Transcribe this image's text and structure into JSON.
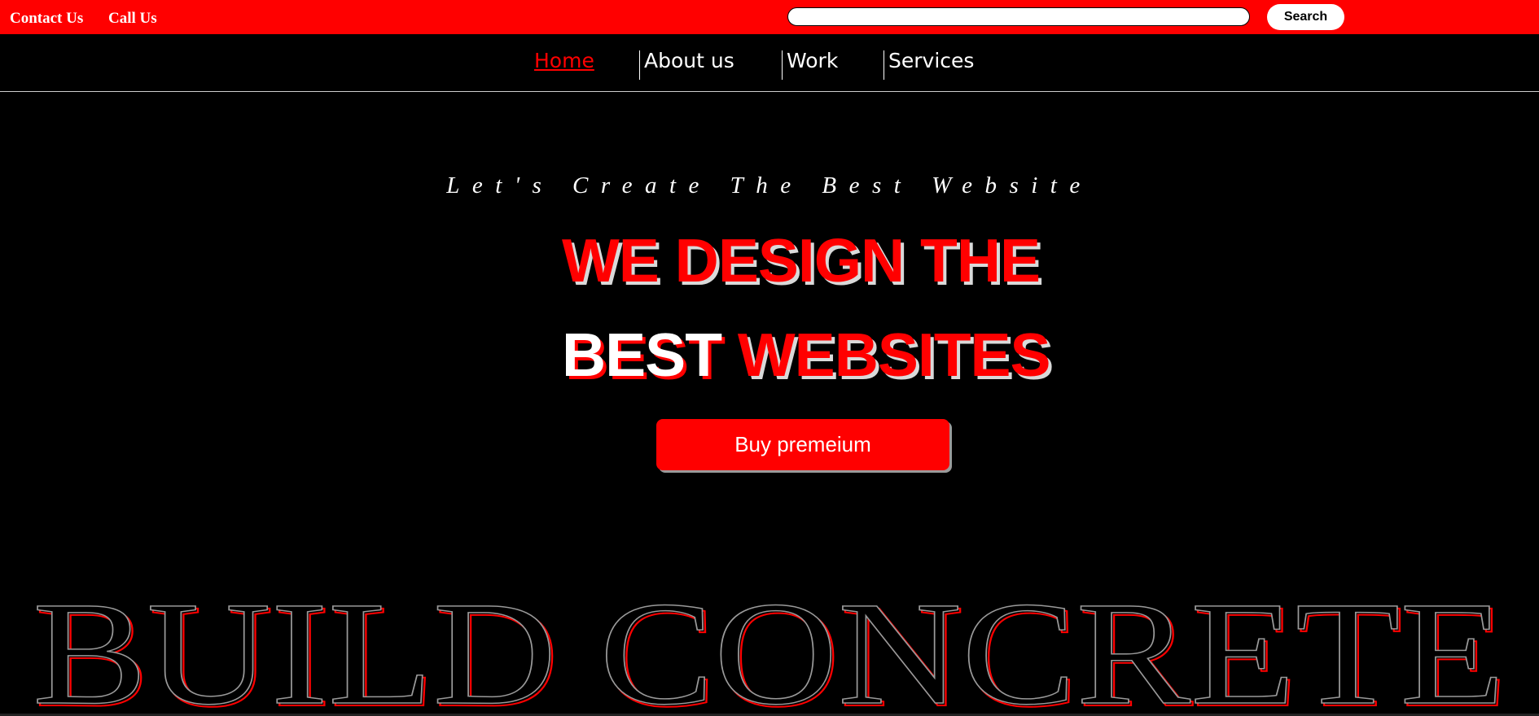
{
  "topbar": {
    "contact_label": "Contact Us",
    "call_label": "Call Us",
    "search_placeholder": "",
    "search_button_label": "Search",
    "background_color": "#ff0000"
  },
  "nav": {
    "items": [
      {
        "label": "Home",
        "active": true
      },
      {
        "label": "About us",
        "active": false
      },
      {
        "label": "Work",
        "active": false
      },
      {
        "label": "Services",
        "active": false
      }
    ],
    "active_color": "#ff0000"
  },
  "hero": {
    "tagline": "Let's Create The Best Website",
    "headline_line1": "WE DESIGN THE",
    "headline_line2_white": "BEST",
    "headline_line2_red": "WEBSITES",
    "cta_label": "Buy premeium"
  },
  "outline_banner": {
    "text": "BUILD CONCRETE",
    "stroke_color": "#9a9a9a",
    "shadow_color": "#ff0000"
  }
}
